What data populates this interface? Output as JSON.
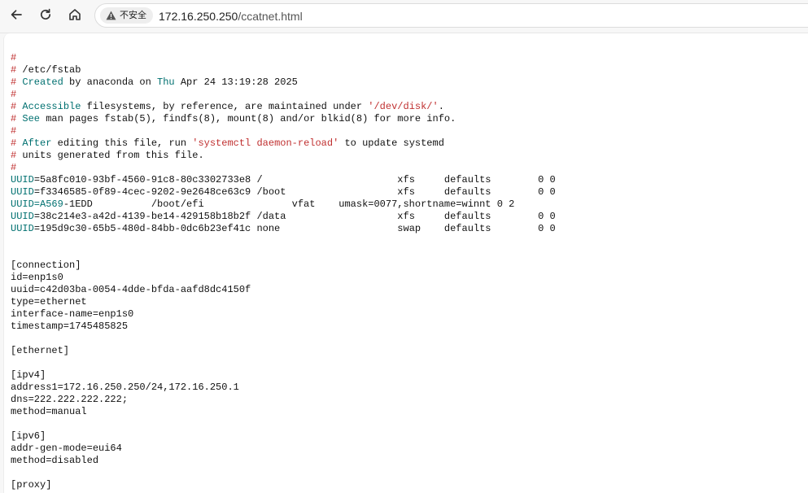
{
  "toolbar": {
    "security_label": "不安全",
    "url_host": "172.16.250.250",
    "url_path": "/ccatnet.html"
  },
  "document_lines": [
    [
      [
        "h",
        "#"
      ]
    ],
    [
      [
        "h",
        "#"
      ],
      [
        "t",
        " /etc/fstab"
      ]
    ],
    [
      [
        "h",
        "#"
      ],
      [
        "k",
        " Created"
      ],
      [
        "t",
        " by anaconda on "
      ],
      [
        "k",
        "Thu"
      ],
      [
        "t",
        " Apr 24 13:19:28 2025"
      ]
    ],
    [
      [
        "h",
        "#"
      ]
    ],
    [
      [
        "h",
        "#"
      ],
      [
        "k",
        " Accessible"
      ],
      [
        "t",
        " filesystems, by reference, are maintained under "
      ],
      [
        "s",
        "'/dev/disk/'"
      ],
      [
        "t",
        "."
      ]
    ],
    [
      [
        "h",
        "#"
      ],
      [
        "k",
        " See"
      ],
      [
        "t",
        " man pages fstab(5), findfs(8), mount(8) and/or blkid(8) for more info."
      ]
    ],
    [
      [
        "h",
        "#"
      ]
    ],
    [
      [
        "h",
        "#"
      ],
      [
        "k",
        " After"
      ],
      [
        "t",
        " editing this file, run "
      ],
      [
        "s",
        "'systemctl daemon-reload'"
      ],
      [
        "t",
        " to update systemd"
      ]
    ],
    [
      [
        "h",
        "#"
      ],
      [
        "t",
        " units generated from this file."
      ]
    ],
    [
      [
        "h",
        "#"
      ]
    ],
    [
      [
        "k",
        "UUID"
      ],
      [
        "t",
        "=5a8fc010-93bf-4560-91c8-80c3302733e8 /                       xfs     defaults        0 0"
      ]
    ],
    [
      [
        "k",
        "UUID"
      ],
      [
        "t",
        "=f3346585-0f89-4cec-9202-9e2648ce63c9 /boot                   xfs     defaults        0 0"
      ]
    ],
    [
      [
        "k",
        "UUID=A569"
      ],
      [
        "t",
        "-1EDD          /boot/efi               vfat    umask=0077,shortname=winnt 0 2"
      ]
    ],
    [
      [
        "k",
        "UUID"
      ],
      [
        "t",
        "=38c214e3-a42d-4139-be14-429158b18b2f /data                   xfs     defaults        0 0"
      ]
    ],
    [
      [
        "k",
        "UUID"
      ],
      [
        "t",
        "=195d9c30-65b5-480d-84bb-0dc6b23ef41c none                    swap    defaults        0 0"
      ]
    ],
    [],
    [],
    [
      [
        "t",
        "[connection]"
      ]
    ],
    [
      [
        "t",
        "id=enp1s0"
      ]
    ],
    [
      [
        "t",
        "uuid=c42d03ba-0054-4dde-bfda-aafd8dc4150f"
      ]
    ],
    [
      [
        "t",
        "type=ethernet"
      ]
    ],
    [
      [
        "t",
        "interface-name=enp1s0"
      ]
    ],
    [
      [
        "t",
        "timestamp=1745485825"
      ]
    ],
    [],
    [
      [
        "t",
        "[ethernet]"
      ]
    ],
    [],
    [
      [
        "t",
        "[ipv4]"
      ]
    ],
    [
      [
        "t",
        "address1=172.16.250.250/24,172.16.250.1"
      ]
    ],
    [
      [
        "t",
        "dns=222.222.222.222;"
      ]
    ],
    [
      [
        "t",
        "method=manual"
      ]
    ],
    [],
    [
      [
        "t",
        "[ipv6]"
      ]
    ],
    [
      [
        "t",
        "addr-gen-mode=eui64"
      ]
    ],
    [
      [
        "t",
        "method=disabled"
      ]
    ],
    [],
    [
      [
        "t",
        "[proxy]"
      ]
    ]
  ],
  "colors": {
    "comment_hash": "#c03030",
    "keyword": "#007070",
    "string": "#c03030"
  },
  "icons": {
    "back": "arrow-left-icon",
    "reload": "reload-icon",
    "home": "home-icon",
    "security": "warning-triangle-icon"
  }
}
